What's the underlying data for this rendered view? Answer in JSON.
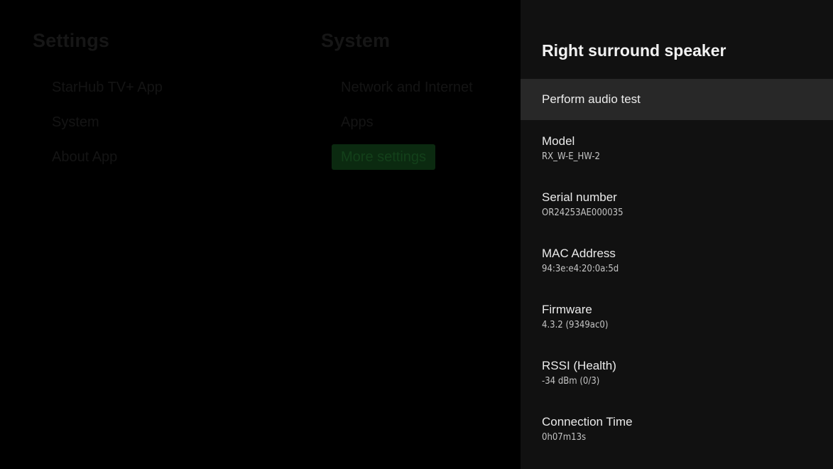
{
  "background": {
    "settings_title": "Settings",
    "settings_items": [
      "StarHub TV+ App",
      "System",
      "About App"
    ],
    "system_title": "System",
    "system_items": [
      "Network and Internet",
      "Apps",
      "More settings"
    ]
  },
  "panel": {
    "title": "Right surround speaker",
    "action_label": "Perform audio test",
    "details": [
      {
        "label": "Model",
        "value": "RX_W-E_HW-2"
      },
      {
        "label": "Serial number",
        "value": "OR24253AE000035"
      },
      {
        "label": "MAC Address",
        "value": "94:3e:e4:20:0a:5d"
      },
      {
        "label": "Firmware",
        "value": "4.3.2 (9349ac0)"
      },
      {
        "label": "RSSI (Health)",
        "value": "-34 dBm (0/3)"
      },
      {
        "label": "Connection Time",
        "value": "0h07m13s"
      }
    ]
  }
}
